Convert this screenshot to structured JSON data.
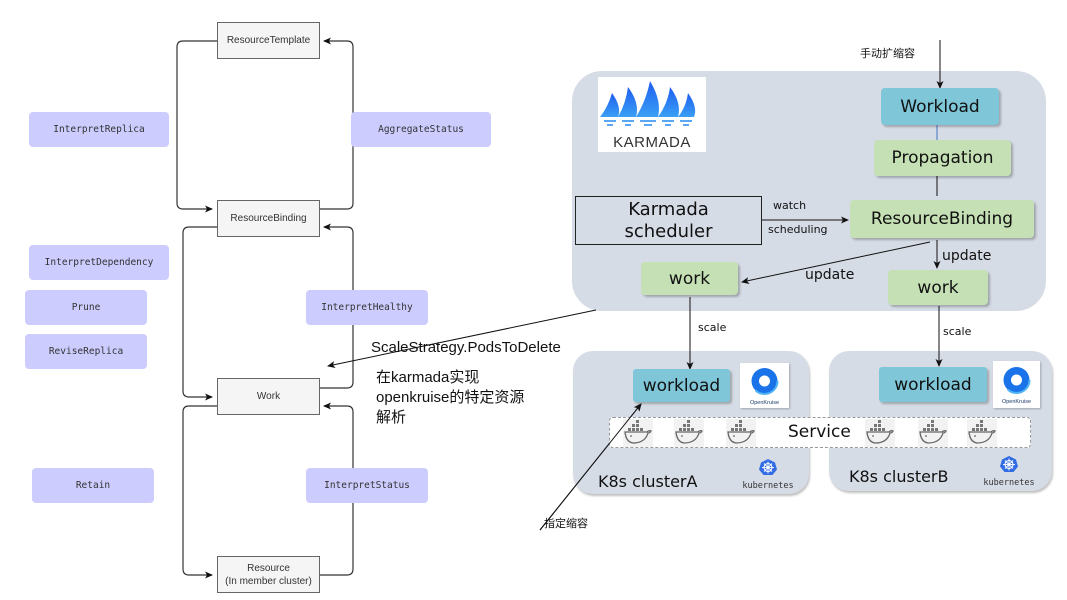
{
  "left_diagram": {
    "stages": {
      "resource_template": "ResourceTemplate",
      "resource_binding": "ResourceBinding",
      "work": "Work",
      "resource_line1": "Resource",
      "resource_line2": "(In member cluster)"
    },
    "operations": {
      "interpret_replica": "InterpretReplica",
      "aggregate_status": "AggregateStatus",
      "interpret_dependency": "InterpretDependency",
      "prune": "Prune",
      "revise_replica": "ReviseReplica",
      "interpret_healthy": "InterpretHealthy",
      "retain": "Retain",
      "interpret_status": "InterpretStatus"
    }
  },
  "annotations": {
    "scale_strategy": "ScaleStrategy.PodsToDelete",
    "impl_note_line1": "在karmada实现",
    "impl_note_line2": "openkruise的特定资源",
    "impl_note_line3": "解析",
    "manual_scale": "手动扩缩容",
    "targeted_scale_down": "指定缩容"
  },
  "karmada": {
    "logo_text": "KARMADA",
    "workload": "Workload",
    "propagation": "Propagation",
    "resource_binding": "ResourceBinding",
    "scheduler_line1": "Karmada",
    "scheduler_line2": "scheduler",
    "watch": "watch",
    "scheduling": "scheduling",
    "update_left": "update",
    "update_right": "update",
    "work_left": "work",
    "work_right": "work",
    "scale_left": "scale",
    "scale_right": "scale"
  },
  "clusters": [
    {
      "name": "K8s clusterA",
      "workload": "workload",
      "kruise_label": "OpenKruise",
      "k8s_label": "kubernetes"
    },
    {
      "name": "K8s clusterB",
      "workload": "workload",
      "kruise_label": "OpenKruise",
      "k8s_label": "kubernetes"
    }
  ],
  "service": {
    "label": "Service",
    "pod_count": 6
  },
  "colors": {
    "operation_fill": "#ccccff",
    "stage_fill": "#f5f5f5",
    "panel_fill": "#d6dce6",
    "workload_fill": "#7ec6d8",
    "green_fill": "#c5e0b4",
    "karmada_blue": "#2b6cf0",
    "kruise_blue": "#1a73e8",
    "k8s_blue": "#326ce5"
  }
}
